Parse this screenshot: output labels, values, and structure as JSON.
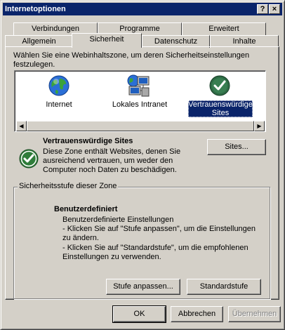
{
  "window": {
    "title": "Internetoptionen",
    "help_button": "?",
    "close_button": "×"
  },
  "tabs": {
    "row1": [
      "Verbindungen",
      "Programme",
      "Erweitert"
    ],
    "row2": [
      "Allgemein",
      "Sicherheit",
      "Datenschutz",
      "Inhalte"
    ],
    "active": "Sicherheit"
  },
  "security": {
    "instruction": "Wählen Sie eine Webinhaltszone, um deren Sicherheitseinstellungen festzulegen.",
    "zones": [
      {
        "label": "Internet",
        "icon": "globe-icon"
      },
      {
        "label": "Lokales Intranet",
        "icon": "intranet-computers-icon"
      },
      {
        "label": "Vertrauenswürdige Sites",
        "icon": "trusted-check-icon",
        "selected": true
      }
    ],
    "selected_zone": {
      "title": "Vertrauenswürdige Sites",
      "description": "Diese Zone enthält Websites, denen Sie ausreichend vertrauen, um weder den Computer noch Daten zu beschädigen.",
      "sites_button": "Sites..."
    },
    "level_group": {
      "legend": "Sicherheitsstufe dieser Zone",
      "level_name": "Benutzerdefiniert",
      "lines": [
        "Benutzerdefinierte Einstellungen",
        "- Klicken Sie auf \"Stufe anpassen\", um die Einstellungen zu ändern.",
        "- Klicken Sie auf \"Standardstufe\", um die empfohlenen Einstellungen zu verwenden."
      ],
      "custom_button": "Stufe anpassen...",
      "default_button": "Standardstufe"
    }
  },
  "footer": {
    "ok": "OK",
    "cancel": "Abbrechen",
    "apply": "Übernehmen"
  },
  "colors": {
    "titlebar": "#0a246a",
    "face": "#d4d0c8",
    "selection": "#0a246a",
    "check_green": "#2f7d3a"
  }
}
